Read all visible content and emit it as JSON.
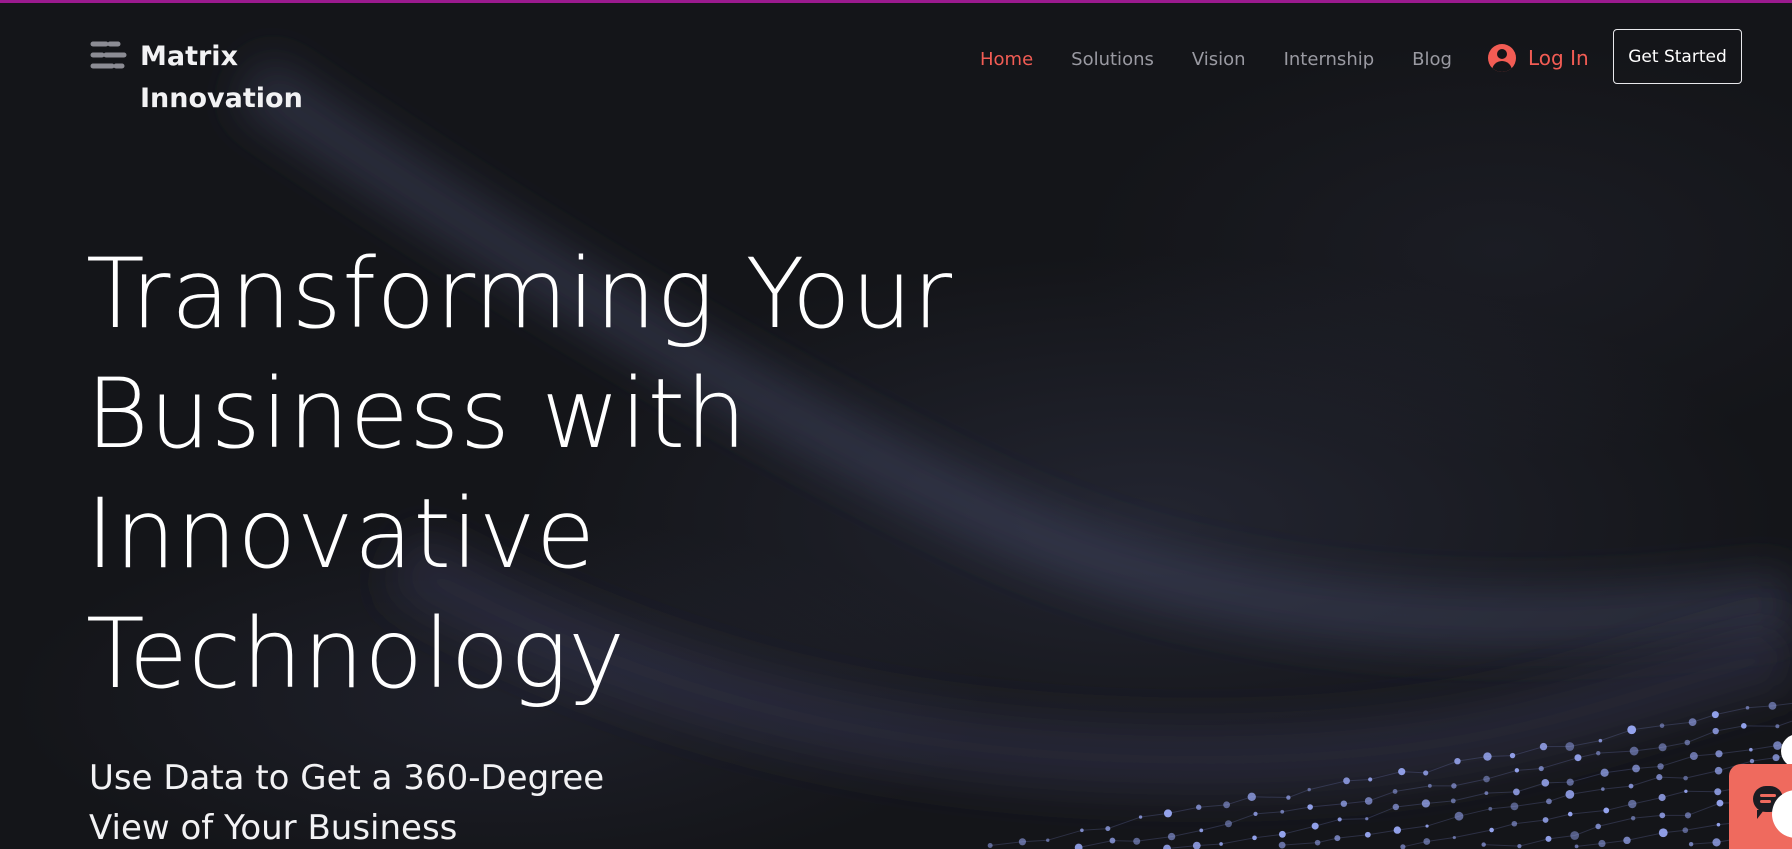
{
  "brand": {
    "name_line1": "Matrix",
    "name_line2": "Innovation"
  },
  "nav": {
    "items": [
      {
        "label": "Home",
        "active": true
      },
      {
        "label": "Solutions",
        "active": false
      },
      {
        "label": "Vision",
        "active": false
      },
      {
        "label": "Internship",
        "active": false
      },
      {
        "label": "Blog",
        "active": false
      }
    ],
    "login_label": "Log In",
    "cta_label": "Get Started"
  },
  "hero": {
    "title_lines": [
      "Transforming Your",
      "Business with",
      "Innovative",
      "Technology"
    ],
    "subtitle_lines": [
      "Use Data to Get a 360-Degree",
      "View of Your Business"
    ]
  },
  "icons": {
    "logo": "matrix-logo-mark",
    "login": "user-circle-icon",
    "chat": "chat-bubble-icon"
  },
  "colors": {
    "background": "#141519",
    "accent": "#f25c54",
    "nav_text": "#9a9aa2",
    "top_bar": "#9a1a8e",
    "chat_widget": "#ef6a5e"
  }
}
